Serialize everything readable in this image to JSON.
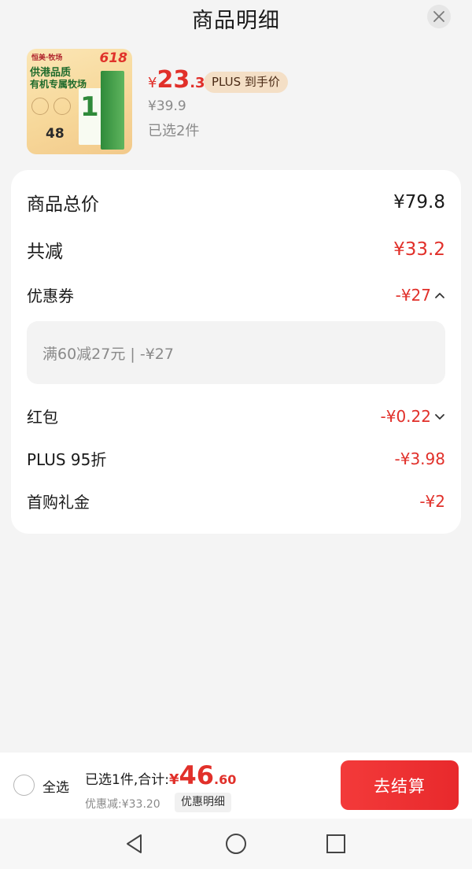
{
  "header": {
    "title": "商品明细"
  },
  "product": {
    "image": {
      "brand": "恒美·牧场",
      "badge": "618",
      "line1": "供港品质",
      "line2": "有机专属牧场",
      "number": "48"
    },
    "price_yen": "¥",
    "price_int": "23",
    "price_dec": ".3",
    "plus_tag": "PLUS 到手价",
    "old_price": "¥39.9",
    "selected_count": "已选2件"
  },
  "summary": {
    "total_label": "商品总价",
    "total_value": "¥79.8",
    "reduction_label": "共减",
    "reduction_value": "¥33.2",
    "coupon_label": "优惠券",
    "coupon_value": "-¥27",
    "coupon_detail": "满60减27元 | -¥27",
    "redpacket_label": "红包",
    "redpacket_value": "-¥0.22",
    "plus_label": "PLUS 95折",
    "plus_value": "-¥3.98",
    "firstbuy_label": "首购礼金",
    "firstbuy_value": "-¥2"
  },
  "bottom": {
    "select_all": "全选",
    "sum_label": "已选1件,合计:",
    "sum_yen": "¥",
    "sum_int": "46",
    "sum_dec": ".60",
    "discount_text": "优惠减:¥33.20",
    "detail_button": "优惠明细",
    "checkout_button": "去结算"
  },
  "icons": {
    "close": "close-icon",
    "coupon_chevron": "chevron-up-icon",
    "redpacket_chevron": "chevron-down-icon",
    "nav_back": "nav-back-icon",
    "nav_home": "nav-home-icon",
    "nav_recent": "nav-recent-icon"
  },
  "colors": {
    "accent": "#e1302a",
    "plus_tag_bg": "#f4dfc6",
    "checkout_bg": "#ee3030"
  }
}
